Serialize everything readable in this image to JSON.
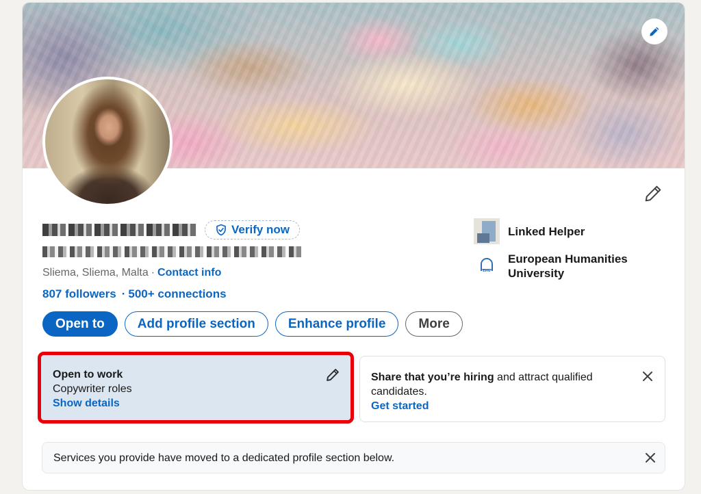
{
  "profile": {
    "name_redacted": true,
    "headline_redacted": true,
    "verify_label": "Verify now",
    "location": "Sliema, Sliema, Malta",
    "location_separator": "·",
    "contact_info_label": "Contact info",
    "followers_label": "807 followers",
    "stats_separator": "·",
    "connections_label": "500+ connections"
  },
  "actions": [
    {
      "label": "Open to",
      "style": "primary"
    },
    {
      "label": "Add profile section",
      "style": "outline"
    },
    {
      "label": "Enhance profile",
      "style": "outline"
    },
    {
      "label": "More",
      "style": "neutral"
    }
  ],
  "organizations": {
    "company": {
      "name": "Linked Helper",
      "icon": "company-logo"
    },
    "school": {
      "name": "European Humanities University",
      "icon": "school-logo"
    }
  },
  "open_to_work": {
    "title": "Open to work",
    "subtitle": "Copywriter roles",
    "link": "Show details",
    "highlight_color": "#e8000b"
  },
  "hiring_card": {
    "bold_text": "Share that you’re hiring",
    "rest_text": " and attract qualified candidates.",
    "link": "Get started"
  },
  "services_notice": {
    "text": "Services you provide have moved to a dedicated profile section below."
  },
  "icons": {
    "banner_edit": "pencil-icon",
    "intro_edit": "pencil-icon",
    "verify": "shield-check-icon",
    "close": "close-icon"
  },
  "colors": {
    "accent": "#0a66c2",
    "open_to_work_bg": "#dce6f1",
    "page_bg": "#f3f2ef"
  }
}
